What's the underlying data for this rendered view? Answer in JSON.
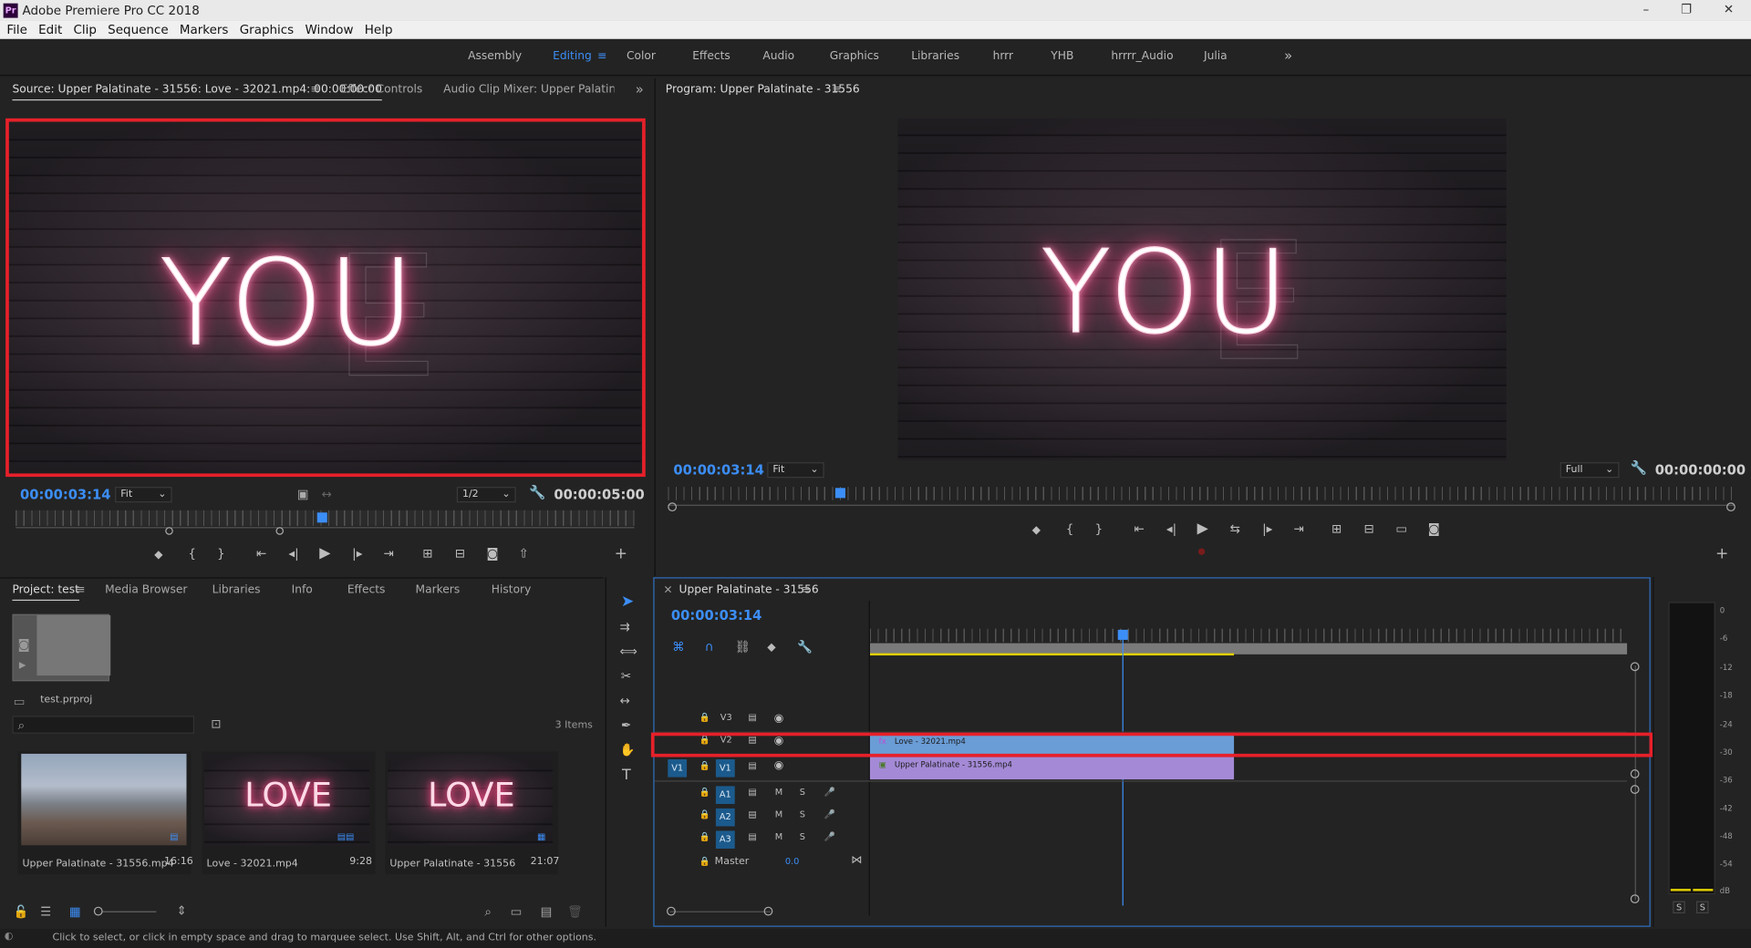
{
  "app": {
    "title": "Adobe Premiere Pro CC 2018",
    "logo": "Pr",
    "win_min": "–",
    "win_max": "❐",
    "win_close": "✕"
  },
  "menu": [
    "File",
    "Edit",
    "Clip",
    "Sequence",
    "Markers",
    "Graphics",
    "Window",
    "Help"
  ],
  "workspaces": {
    "items": [
      "Assembly",
      "Editing",
      "Color",
      "Effects",
      "Audio",
      "Graphics",
      "Libraries",
      "hrrr",
      "YHB",
      "hrrrr_Audio",
      "Julia"
    ],
    "active": "Editing",
    "menu_icon": "≡",
    "more": "»"
  },
  "source": {
    "tabs": [
      "Source: Upper Palatinate - 31556: Love - 32021.mp4: 00:00:00:00",
      "Effect Controls",
      "Audio Clip Mixer: Upper Palatinate - 3"
    ],
    "menu_icon": "≡",
    "more": "»",
    "text_lit": "YOU",
    "text_unlit": "E",
    "timecode": "00:00:03:14",
    "zoom": "Fit",
    "resolution": "1/2",
    "duration": "00:00:05:00",
    "highlight_color": "#e6202a"
  },
  "program": {
    "title": "Program: Upper Palatinate - 31556",
    "menu_icon": "≡",
    "text_lit": "YOU",
    "text_unlit": "E",
    "timecode": "00:00:03:14",
    "zoom": "Fit",
    "quality": "Full",
    "duration": "00:00:00:00"
  },
  "project": {
    "tabs": [
      "Project: test",
      "Media Browser",
      "Libraries",
      "Info",
      "Effects",
      "Markers",
      "History"
    ],
    "menu_icon": "≡",
    "file": "test.prproj",
    "search_placeholder": "",
    "items_count": "3 Items",
    "items": [
      {
        "name": "Upper Palatinate - 31556.mp4",
        "duration": "16:16",
        "text": ""
      },
      {
        "name": "Love - 32021.mp4",
        "duration": "9:28",
        "text": "LOVE"
      },
      {
        "name": "Upper Palatinate - 31556",
        "duration": "21:07",
        "text": "LOVE"
      }
    ]
  },
  "timeline": {
    "title": "Upper Palatinate - 31556",
    "close": "×",
    "menu_icon": "≡",
    "timecode": "00:00:03:14",
    "tracks": [
      {
        "id": "V3",
        "kind": "video"
      },
      {
        "id": "V2",
        "kind": "video"
      },
      {
        "id": "V1",
        "kind": "video",
        "source": "V1"
      },
      {
        "id": "A1",
        "kind": "audio"
      },
      {
        "id": "A2",
        "kind": "audio"
      },
      {
        "id": "A3",
        "kind": "audio"
      }
    ],
    "master_label": "Master",
    "master_value": "0.0",
    "mute": "M",
    "solo": "S",
    "clips": [
      {
        "track": "V2",
        "name": "Love - 32021.mp4",
        "color": "#6a9cd6"
      },
      {
        "track": "V1",
        "name": "Upper Palatinate - 31556.mp4",
        "color": "#a48ad6"
      }
    ],
    "highlight_color": "#e6202a"
  },
  "meter": {
    "scale": [
      "0",
      "-6",
      "-12",
      "-18",
      "-24",
      "-30",
      "-36",
      "-42",
      "-48",
      "-54",
      "dB"
    ],
    "solo": "S"
  },
  "status": {
    "text": "Click to select, or click in empty space and drag to marquee select. Use Shift, Alt, and Ctrl for other options."
  }
}
